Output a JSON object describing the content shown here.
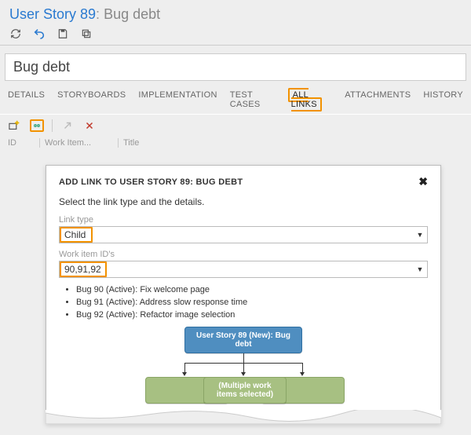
{
  "header": {
    "breadcrumb_item": "User Story 89",
    "breadcrumb_sep": ":",
    "breadcrumb_title": "Bug debt"
  },
  "title_field": {
    "value": "Bug debt"
  },
  "tabs": {
    "details": "DETAILS",
    "storyboards": "STORYBOARDS",
    "implementation": "IMPLEMENTATION",
    "testcases": "TEST CASES",
    "alllinks": "ALL LINKS",
    "attachments": "ATTACHMENTS",
    "history": "HISTORY"
  },
  "cols": {
    "id": "ID",
    "type": "Work Item...",
    "title": "Title"
  },
  "dialog": {
    "title": "ADD LINK TO USER STORY 89: BUG DEBT",
    "instruction": "Select the link type and the details.",
    "link_type_label": "Link type",
    "link_type_value": "Child",
    "ids_label": "Work item ID's",
    "ids_value": "90,91,92",
    "items": [
      "Bug 90 (Active): Fix welcome page",
      "Bug 91 (Active): Address slow response time",
      "Bug 92 (Active): Refactor image selection"
    ],
    "graph": {
      "parent": "User Story 89 (New): Bug debt",
      "selected": "(Multiple work items selected)"
    }
  }
}
